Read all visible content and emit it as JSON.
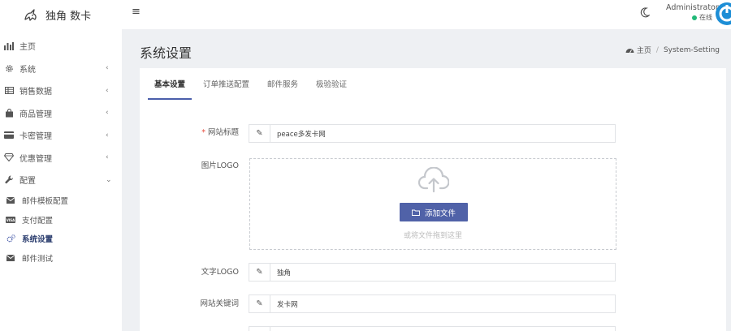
{
  "brand": {
    "name": "独角 数卡"
  },
  "sidebar": {
    "items": [
      {
        "label": "主页",
        "icon": "bar-chart-icon",
        "chevron": ""
      },
      {
        "label": "系统",
        "icon": "gear-icon",
        "chevron": "‹"
      },
      {
        "label": "销售数据",
        "icon": "table-icon",
        "chevron": "‹"
      },
      {
        "label": "商品管理",
        "icon": "shopping-bag-icon",
        "chevron": "‹"
      },
      {
        "label": "卡密管理",
        "icon": "credit-card-icon",
        "chevron": "‹"
      },
      {
        "label": "优惠管理",
        "icon": "diamond-icon",
        "chevron": "‹"
      },
      {
        "label": "配置",
        "icon": "wrench-icon",
        "chevron": "⌄"
      }
    ],
    "subitems": [
      {
        "label": "邮件模板配置",
        "icon": "envelope-icon"
      },
      {
        "label": "支付配置",
        "icon": "visa-icon"
      },
      {
        "label": "系统设置",
        "icon": "gears-icon",
        "active": true
      },
      {
        "label": "邮件测试",
        "icon": "envelope-icon"
      }
    ]
  },
  "topbar": {
    "user_name": "Administrator",
    "user_status": "在线",
    "status_color": "#21b978"
  },
  "page": {
    "title": "系统设置",
    "breadcrumb": {
      "home": "主页",
      "separator": "/",
      "current": "System-Setting"
    }
  },
  "tabs": [
    "基本设置",
    "订单推送配置",
    "邮件服务",
    "极验验证"
  ],
  "form": {
    "site_title_label": "网站标题",
    "required_mark": "*",
    "site_title_value": "peace多发卡网",
    "logo_label": "图片LOGO",
    "add_file_label": "添加文件",
    "drop_hint": "或将文件拖到这里",
    "text_logo_label": "文字LOGO",
    "text_logo_value": "独角",
    "keywords_label": "网站关键词",
    "keywords_value": "发卡网"
  },
  "colors": {
    "accent": "#5062a8",
    "tab_underline": "#4b5fab",
    "avatar_bg": "#1d8ed6"
  }
}
